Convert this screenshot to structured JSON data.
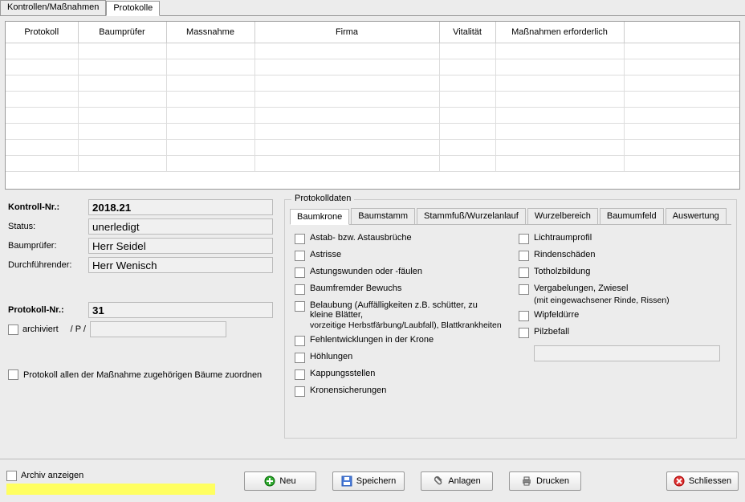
{
  "top_tabs": {
    "kontrollen": "Kontrollen/Maßnahmen",
    "protokolle": "Protokolle"
  },
  "grid": {
    "col0": "Protokoll",
    "col1": "Baumprüfer",
    "col2": "Massnahme",
    "col3": "Firma",
    "col4": "Vitalität",
    "col5": "Maßnahmen erforderlich",
    "col6": ""
  },
  "kontroll": {
    "nr_label": "Kontroll-Nr.:",
    "nr_value": "2018.21",
    "status_label": "Status:",
    "status_value": "unerledigt",
    "pruefer_label": "Baumprüfer:",
    "pruefer_value": "Herr Seidel",
    "durch_label": "Durchführender:",
    "durch_value": "Herr Wenisch"
  },
  "protokoll": {
    "nr_label": "Protokoll-Nr.:",
    "nr_value": "31",
    "archiviert_label": "archiviert",
    "slashp": "/ P /",
    "assign_label": "Protokoll allen der Maßnahme zugehörigen Bäume zuordnen"
  },
  "fs": {
    "legend": "Protokolldaten",
    "tabs": {
      "baumkrone": "Baumkrone",
      "baumstamm": "Baumstamm",
      "stammfuss": "Stammfuß/Wurzelanlauf",
      "wurzelbereich": "Wurzelbereich",
      "baumumfeld": "Baumumfeld",
      "auswertung": "Auswertung"
    },
    "left": {
      "c1": "Astab- bzw. Astausbrüche",
      "c2": "Astrisse",
      "c3": "Astungswunden oder -fäulen",
      "c4": "Baumfremder Bewuchs",
      "c5a": "Belaubung (Auffälligkeiten z.B. schütter, zu kleine Blätter,",
      "c5b": "vorzeitige Herbstfärbung/Laubfall), Blattkrankheiten",
      "c6": "Fehlentwicklungen in der Krone",
      "c7": "Höhlungen",
      "c8": "Kappungsstellen",
      "c9": "Kronensicherungen"
    },
    "right": {
      "c1": "Lichtraumprofil",
      "c2": "Rindenschäden",
      "c3": "Totholzbildung",
      "c4": "Vergabelungen, Zwiesel",
      "c4s": "(mit eingewachsener Rinde, Rissen)",
      "c5": "Wipfeldürre",
      "c6": "Pilzbefall"
    }
  },
  "footer": {
    "archiv": "Archiv anzeigen",
    "neu": "Neu",
    "speichern": "Speichern",
    "anlagen": "Anlagen",
    "drucken": "Drucken",
    "schliessen": "Schliessen"
  }
}
